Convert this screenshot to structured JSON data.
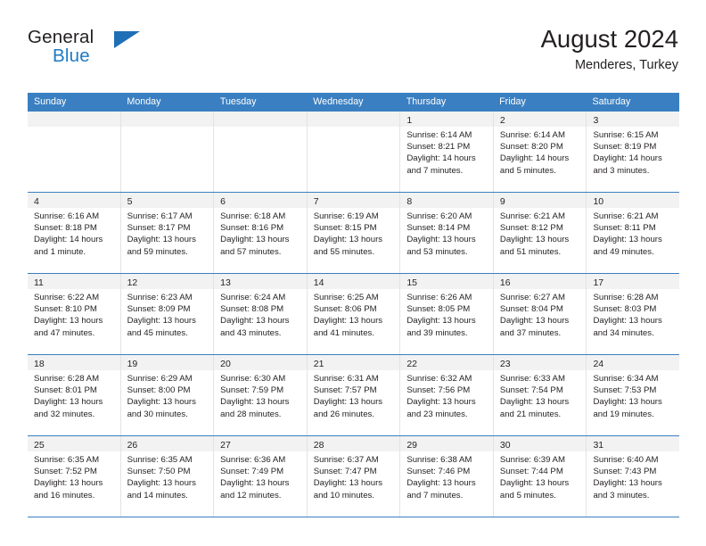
{
  "brand": {
    "name_top": "General",
    "name_bottom": "Blue",
    "triangle_icon": "brand-triangle-icon",
    "accent_color": "#1f7ac4"
  },
  "header": {
    "title": "August 2024",
    "subtitle": "Menderes, Turkey"
  },
  "colors": {
    "header_blue": "#3a7fc1",
    "daynum_band": "#f2f2f2",
    "text": "#231f20",
    "cell_divider": "#e3e3e3"
  },
  "calendar": {
    "weekday_headers": [
      "Sunday",
      "Monday",
      "Tuesday",
      "Wednesday",
      "Thursday",
      "Friday",
      "Saturday"
    ],
    "weeks": [
      [
        {
          "day": "",
          "empty": true,
          "lines": []
        },
        {
          "day": "",
          "empty": true,
          "lines": []
        },
        {
          "day": "",
          "empty": true,
          "lines": []
        },
        {
          "day": "",
          "empty": true,
          "lines": []
        },
        {
          "day": "1",
          "empty": false,
          "lines": [
            "Sunrise: 6:14 AM",
            "Sunset: 8:21 PM",
            "Daylight: 14 hours",
            "and 7 minutes."
          ]
        },
        {
          "day": "2",
          "empty": false,
          "lines": [
            "Sunrise: 6:14 AM",
            "Sunset: 8:20 PM",
            "Daylight: 14 hours",
            "and 5 minutes."
          ]
        },
        {
          "day": "3",
          "empty": false,
          "lines": [
            "Sunrise: 6:15 AM",
            "Sunset: 8:19 PM",
            "Daylight: 14 hours",
            "and 3 minutes."
          ]
        }
      ],
      [
        {
          "day": "4",
          "empty": false,
          "lines": [
            "Sunrise: 6:16 AM",
            "Sunset: 8:18 PM",
            "Daylight: 14 hours",
            "and 1 minute."
          ]
        },
        {
          "day": "5",
          "empty": false,
          "lines": [
            "Sunrise: 6:17 AM",
            "Sunset: 8:17 PM",
            "Daylight: 13 hours",
            "and 59 minutes."
          ]
        },
        {
          "day": "6",
          "empty": false,
          "lines": [
            "Sunrise: 6:18 AM",
            "Sunset: 8:16 PM",
            "Daylight: 13 hours",
            "and 57 minutes."
          ]
        },
        {
          "day": "7",
          "empty": false,
          "lines": [
            "Sunrise: 6:19 AM",
            "Sunset: 8:15 PM",
            "Daylight: 13 hours",
            "and 55 minutes."
          ]
        },
        {
          "day": "8",
          "empty": false,
          "lines": [
            "Sunrise: 6:20 AM",
            "Sunset: 8:14 PM",
            "Daylight: 13 hours",
            "and 53 minutes."
          ]
        },
        {
          "day": "9",
          "empty": false,
          "lines": [
            "Sunrise: 6:21 AM",
            "Sunset: 8:12 PM",
            "Daylight: 13 hours",
            "and 51 minutes."
          ]
        },
        {
          "day": "10",
          "empty": false,
          "lines": [
            "Sunrise: 6:21 AM",
            "Sunset: 8:11 PM",
            "Daylight: 13 hours",
            "and 49 minutes."
          ]
        }
      ],
      [
        {
          "day": "11",
          "empty": false,
          "lines": [
            "Sunrise: 6:22 AM",
            "Sunset: 8:10 PM",
            "Daylight: 13 hours",
            "and 47 minutes."
          ]
        },
        {
          "day": "12",
          "empty": false,
          "lines": [
            "Sunrise: 6:23 AM",
            "Sunset: 8:09 PM",
            "Daylight: 13 hours",
            "and 45 minutes."
          ]
        },
        {
          "day": "13",
          "empty": false,
          "lines": [
            "Sunrise: 6:24 AM",
            "Sunset: 8:08 PM",
            "Daylight: 13 hours",
            "and 43 minutes."
          ]
        },
        {
          "day": "14",
          "empty": false,
          "lines": [
            "Sunrise: 6:25 AM",
            "Sunset: 8:06 PM",
            "Daylight: 13 hours",
            "and 41 minutes."
          ]
        },
        {
          "day": "15",
          "empty": false,
          "lines": [
            "Sunrise: 6:26 AM",
            "Sunset: 8:05 PM",
            "Daylight: 13 hours",
            "and 39 minutes."
          ]
        },
        {
          "day": "16",
          "empty": false,
          "lines": [
            "Sunrise: 6:27 AM",
            "Sunset: 8:04 PM",
            "Daylight: 13 hours",
            "and 37 minutes."
          ]
        },
        {
          "day": "17",
          "empty": false,
          "lines": [
            "Sunrise: 6:28 AM",
            "Sunset: 8:03 PM",
            "Daylight: 13 hours",
            "and 34 minutes."
          ]
        }
      ],
      [
        {
          "day": "18",
          "empty": false,
          "lines": [
            "Sunrise: 6:28 AM",
            "Sunset: 8:01 PM",
            "Daylight: 13 hours",
            "and 32 minutes."
          ]
        },
        {
          "day": "19",
          "empty": false,
          "lines": [
            "Sunrise: 6:29 AM",
            "Sunset: 8:00 PM",
            "Daylight: 13 hours",
            "and 30 minutes."
          ]
        },
        {
          "day": "20",
          "empty": false,
          "lines": [
            "Sunrise: 6:30 AM",
            "Sunset: 7:59 PM",
            "Daylight: 13 hours",
            "and 28 minutes."
          ]
        },
        {
          "day": "21",
          "empty": false,
          "lines": [
            "Sunrise: 6:31 AM",
            "Sunset: 7:57 PM",
            "Daylight: 13 hours",
            "and 26 minutes."
          ]
        },
        {
          "day": "22",
          "empty": false,
          "lines": [
            "Sunrise: 6:32 AM",
            "Sunset: 7:56 PM",
            "Daylight: 13 hours",
            "and 23 minutes."
          ]
        },
        {
          "day": "23",
          "empty": false,
          "lines": [
            "Sunrise: 6:33 AM",
            "Sunset: 7:54 PM",
            "Daylight: 13 hours",
            "and 21 minutes."
          ]
        },
        {
          "day": "24",
          "empty": false,
          "lines": [
            "Sunrise: 6:34 AM",
            "Sunset: 7:53 PM",
            "Daylight: 13 hours",
            "and 19 minutes."
          ]
        }
      ],
      [
        {
          "day": "25",
          "empty": false,
          "lines": [
            "Sunrise: 6:35 AM",
            "Sunset: 7:52 PM",
            "Daylight: 13 hours",
            "and 16 minutes."
          ]
        },
        {
          "day": "26",
          "empty": false,
          "lines": [
            "Sunrise: 6:35 AM",
            "Sunset: 7:50 PM",
            "Daylight: 13 hours",
            "and 14 minutes."
          ]
        },
        {
          "day": "27",
          "empty": false,
          "lines": [
            "Sunrise: 6:36 AM",
            "Sunset: 7:49 PM",
            "Daylight: 13 hours",
            "and 12 minutes."
          ]
        },
        {
          "day": "28",
          "empty": false,
          "lines": [
            "Sunrise: 6:37 AM",
            "Sunset: 7:47 PM",
            "Daylight: 13 hours",
            "and 10 minutes."
          ]
        },
        {
          "day": "29",
          "empty": false,
          "lines": [
            "Sunrise: 6:38 AM",
            "Sunset: 7:46 PM",
            "Daylight: 13 hours",
            "and 7 minutes."
          ]
        },
        {
          "day": "30",
          "empty": false,
          "lines": [
            "Sunrise: 6:39 AM",
            "Sunset: 7:44 PM",
            "Daylight: 13 hours",
            "and 5 minutes."
          ]
        },
        {
          "day": "31",
          "empty": false,
          "lines": [
            "Sunrise: 6:40 AM",
            "Sunset: 7:43 PM",
            "Daylight: 13 hours",
            "and 3 minutes."
          ]
        }
      ]
    ]
  }
}
